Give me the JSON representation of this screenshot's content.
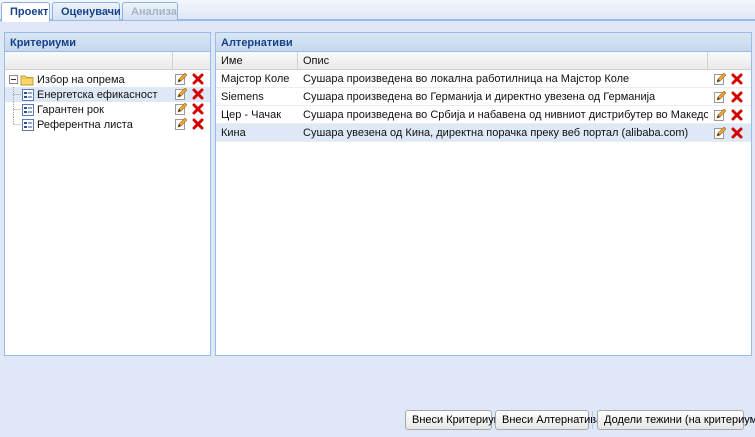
{
  "tabs": [
    {
      "label": "Проект",
      "state": "active"
    },
    {
      "label": "Оценувачи",
      "state": "normal"
    },
    {
      "label": "Анализа",
      "state": "disabled"
    }
  ],
  "criteria_panel": {
    "title": "Критериуми",
    "tree": {
      "root": {
        "label": "Избор на опрема",
        "icon": "folder-icon"
      },
      "children": [
        {
          "label": "Енергетска ефикасност",
          "icon": "node-icon",
          "selected": true
        },
        {
          "label": "Гарантен рок",
          "icon": "node-icon",
          "selected": false
        },
        {
          "label": "Референтна листа",
          "icon": "node-icon",
          "selected": false
        }
      ]
    }
  },
  "alternatives_panel": {
    "title": "Алтернативи",
    "columns": [
      "Име",
      "Опис",
      ""
    ],
    "rows": [
      {
        "name": "Мајстор Коле",
        "desc": "Сушара произведена во локална работилница на Мајстор Коле",
        "selected": false
      },
      {
        "name": "Siemens",
        "desc": "Сушара произведена во Германија и директно увезена од Германија",
        "selected": false
      },
      {
        "name": "Цер - Чачак",
        "desc": "Сушара произведена во Србија и набавена од нивниот дистрибутер во Македонија",
        "selected": false
      },
      {
        "name": "Кина",
        "desc": "Сушара увезена од Кина, директна порачка преку веб портал (alibaba.com)",
        "selected": true
      }
    ]
  },
  "toolbar": {
    "add_criterion": "Внеси Критериум",
    "add_alternative": "Внеси Алтернатива",
    "assign_weights": "Додели тежини (на критериуми)"
  },
  "colors": {
    "accent": "#15428b",
    "panel_border": "#99bbe8",
    "background": "#dfe8f6",
    "selected_row": "#dfe8f6",
    "delete_red": "#d40000"
  }
}
